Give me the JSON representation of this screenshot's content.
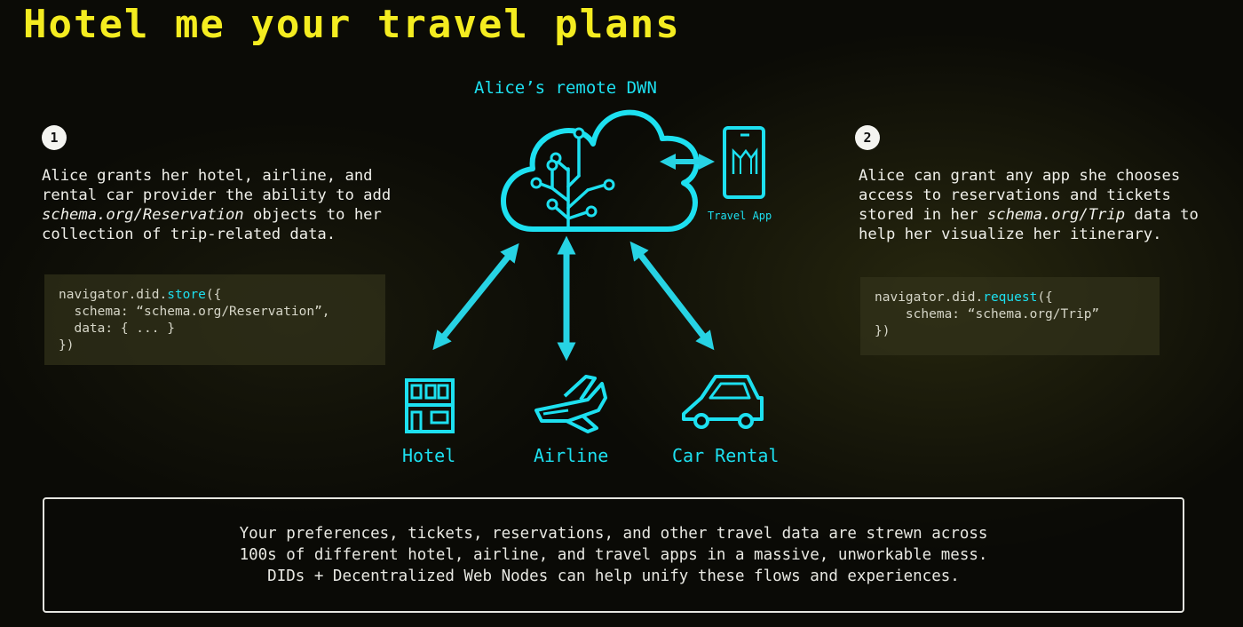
{
  "title": "Hotel me your travel plans",
  "dwn": {
    "label": "Alice’s remote DWN"
  },
  "travel_app": {
    "label": "Travel App"
  },
  "endpoints": {
    "hotel": "Hotel",
    "airline": "Airline",
    "car_rental": "Car Rental"
  },
  "step1": {
    "number": "1",
    "text_before": "Alice grants her hotel, airline, and rental car provider the ability to add ",
    "text_em": "schema.org/Reservation",
    "text_after": " objects to her collection of trip-related data.",
    "code": {
      "line1_prefix": "navigator.did.",
      "line1_method": "store",
      "line1_suffix": "({",
      "line2": "  schema: “schema.org/Reservation”,",
      "line3": "  data: { ... }",
      "line4": "})"
    }
  },
  "step2": {
    "number": "2",
    "text_before": "Alice can grant any app she chooses access to reservations and tickets stored in her ",
    "text_em": "schema.org/Trip",
    "text_after": " data to help her visualize her itinerary.",
    "code": {
      "line1_prefix": "navigator.did.",
      "line1_method": "request",
      "line1_suffix": "({",
      "line2": "    schema: “schema.org/Trip”",
      "line3": "})"
    }
  },
  "summary": {
    "line1": "Your preferences, tickets, reservations, and other travel data are strewn across",
    "line2": "100s of different hotel, airline, and travel apps in a massive, unworkable mess.",
    "line3": "DIDs + Decentralized Web Nodes can help unify these flows and experiences."
  },
  "colors": {
    "accent_cyan": "#1de0f0",
    "title_yellow": "#f4ec20",
    "background": "#0b0b06"
  }
}
